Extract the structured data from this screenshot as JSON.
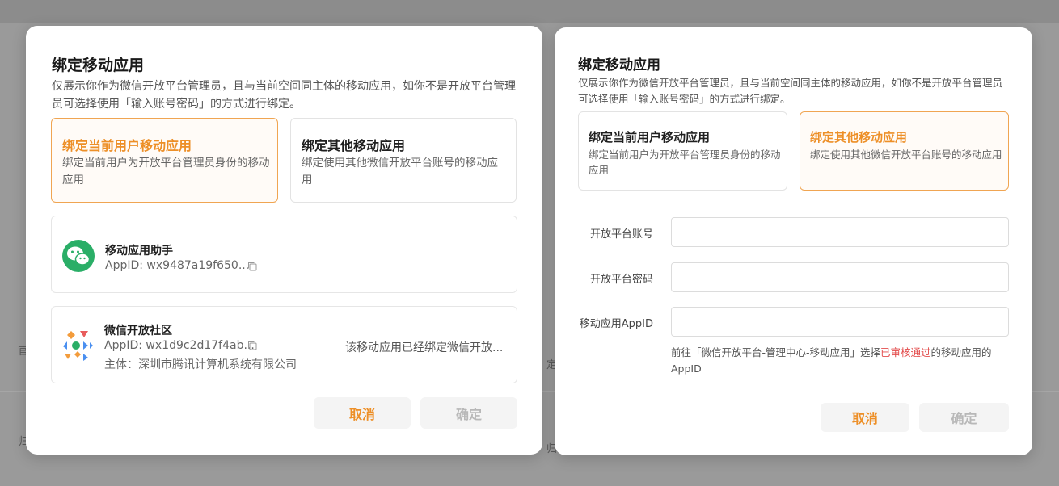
{
  "background": {
    "fragments": [
      "官",
      "归",
      "定",
      "归"
    ]
  },
  "left_dialog": {
    "title": "绑定移动应用",
    "description": "仅展示你作为微信开放平台管理员，且与当前空间同主体的移动应用，如你不是开放平台管理员可选择使用「输入账号密码」的方式进行绑定。",
    "options": [
      {
        "title": "绑定当前用户移动应用",
        "description": "绑定当前用户为开放平台管理员身份的移动应用",
        "selected": true
      },
      {
        "title": "绑定其他移动应用",
        "description": "绑定使用其他微信开放平台账号的移动应用",
        "selected": false
      }
    ],
    "apps": [
      {
        "name": "移动应用助手",
        "appid": "AppID: wx9487a19f650..."
      },
      {
        "name": "微信开放社区",
        "appid": "AppID: wx1d9c2d17f4ab...",
        "subject": "主体：深圳市腾讯计算机系统有限公司",
        "status": "该移动应用已经绑定微信开放..."
      }
    ],
    "cancel_label": "取消",
    "confirm_label": "确定"
  },
  "right_dialog": {
    "title": "绑定移动应用",
    "description": "仅展示你作为微信开放平台管理员，且与当前空间同主体的移动应用，如你不是开放平台管理员可选择使用「输入账号密码」的方式进行绑定。",
    "options": [
      {
        "title": "绑定当前用户移动应用",
        "description": "绑定当前用户为开放平台管理员身份的移动应用",
        "selected": false
      },
      {
        "title": "绑定其他移动应用",
        "description": "绑定使用其他微信开放平台账号的移动应用",
        "selected": true
      }
    ],
    "form": {
      "account_label": "开放平台账号",
      "account_value": "",
      "password_label": "开放平台密码",
      "password_value": "",
      "appid_label": "移动应用AppID",
      "appid_value": "",
      "hint_prefix": "前往「微信开放平台-管理中心-移动应用」选择",
      "hint_highlight": "已审核通过",
      "hint_suffix": "的移动应用的AppID"
    },
    "cancel_label": "取消",
    "confirm_label": "确定"
  },
  "colors": {
    "accent": "#ed8f27",
    "selected_border": "#f0a552",
    "highlight_red": "#e34d4d",
    "wechat_green": "#2aae67"
  }
}
